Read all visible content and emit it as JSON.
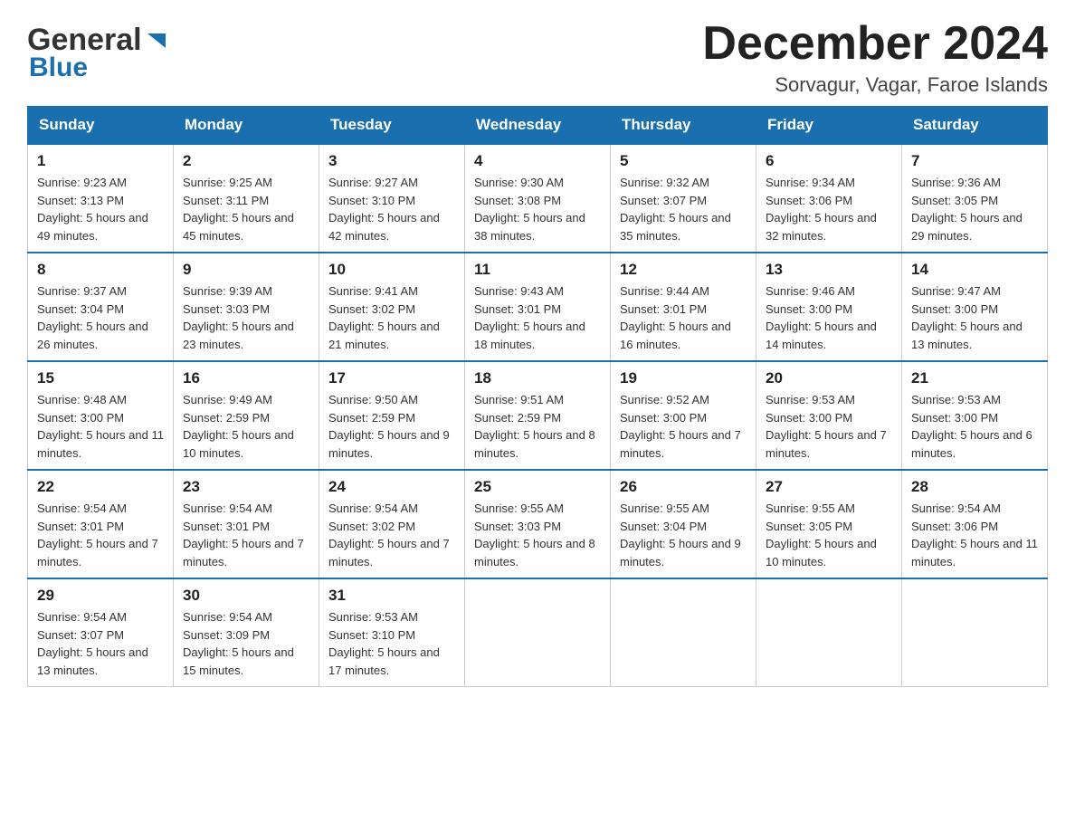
{
  "header": {
    "logo_top": "General",
    "logo_bottom": "Blue",
    "month_title": "December 2024",
    "location": "Sorvagur, Vagar, Faroe Islands"
  },
  "days_of_week": [
    "Sunday",
    "Monday",
    "Tuesday",
    "Wednesday",
    "Thursday",
    "Friday",
    "Saturday"
  ],
  "weeks": [
    [
      {
        "day": "1",
        "sunrise": "Sunrise: 9:23 AM",
        "sunset": "Sunset: 3:13 PM",
        "daylight": "Daylight: 5 hours and 49 minutes."
      },
      {
        "day": "2",
        "sunrise": "Sunrise: 9:25 AM",
        "sunset": "Sunset: 3:11 PM",
        "daylight": "Daylight: 5 hours and 45 minutes."
      },
      {
        "day": "3",
        "sunrise": "Sunrise: 9:27 AM",
        "sunset": "Sunset: 3:10 PM",
        "daylight": "Daylight: 5 hours and 42 minutes."
      },
      {
        "day": "4",
        "sunrise": "Sunrise: 9:30 AM",
        "sunset": "Sunset: 3:08 PM",
        "daylight": "Daylight: 5 hours and 38 minutes."
      },
      {
        "day": "5",
        "sunrise": "Sunrise: 9:32 AM",
        "sunset": "Sunset: 3:07 PM",
        "daylight": "Daylight: 5 hours and 35 minutes."
      },
      {
        "day": "6",
        "sunrise": "Sunrise: 9:34 AM",
        "sunset": "Sunset: 3:06 PM",
        "daylight": "Daylight: 5 hours and 32 minutes."
      },
      {
        "day": "7",
        "sunrise": "Sunrise: 9:36 AM",
        "sunset": "Sunset: 3:05 PM",
        "daylight": "Daylight: 5 hours and 29 minutes."
      }
    ],
    [
      {
        "day": "8",
        "sunrise": "Sunrise: 9:37 AM",
        "sunset": "Sunset: 3:04 PM",
        "daylight": "Daylight: 5 hours and 26 minutes."
      },
      {
        "day": "9",
        "sunrise": "Sunrise: 9:39 AM",
        "sunset": "Sunset: 3:03 PM",
        "daylight": "Daylight: 5 hours and 23 minutes."
      },
      {
        "day": "10",
        "sunrise": "Sunrise: 9:41 AM",
        "sunset": "Sunset: 3:02 PM",
        "daylight": "Daylight: 5 hours and 21 minutes."
      },
      {
        "day": "11",
        "sunrise": "Sunrise: 9:43 AM",
        "sunset": "Sunset: 3:01 PM",
        "daylight": "Daylight: 5 hours and 18 minutes."
      },
      {
        "day": "12",
        "sunrise": "Sunrise: 9:44 AM",
        "sunset": "Sunset: 3:01 PM",
        "daylight": "Daylight: 5 hours and 16 minutes."
      },
      {
        "day": "13",
        "sunrise": "Sunrise: 9:46 AM",
        "sunset": "Sunset: 3:00 PM",
        "daylight": "Daylight: 5 hours and 14 minutes."
      },
      {
        "day": "14",
        "sunrise": "Sunrise: 9:47 AM",
        "sunset": "Sunset: 3:00 PM",
        "daylight": "Daylight: 5 hours and 13 minutes."
      }
    ],
    [
      {
        "day": "15",
        "sunrise": "Sunrise: 9:48 AM",
        "sunset": "Sunset: 3:00 PM",
        "daylight": "Daylight: 5 hours and 11 minutes."
      },
      {
        "day": "16",
        "sunrise": "Sunrise: 9:49 AM",
        "sunset": "Sunset: 2:59 PM",
        "daylight": "Daylight: 5 hours and 10 minutes."
      },
      {
        "day": "17",
        "sunrise": "Sunrise: 9:50 AM",
        "sunset": "Sunset: 2:59 PM",
        "daylight": "Daylight: 5 hours and 9 minutes."
      },
      {
        "day": "18",
        "sunrise": "Sunrise: 9:51 AM",
        "sunset": "Sunset: 2:59 PM",
        "daylight": "Daylight: 5 hours and 8 minutes."
      },
      {
        "day": "19",
        "sunrise": "Sunrise: 9:52 AM",
        "sunset": "Sunset: 3:00 PM",
        "daylight": "Daylight: 5 hours and 7 minutes."
      },
      {
        "day": "20",
        "sunrise": "Sunrise: 9:53 AM",
        "sunset": "Sunset: 3:00 PM",
        "daylight": "Daylight: 5 hours and 7 minutes."
      },
      {
        "day": "21",
        "sunrise": "Sunrise: 9:53 AM",
        "sunset": "Sunset: 3:00 PM",
        "daylight": "Daylight: 5 hours and 6 minutes."
      }
    ],
    [
      {
        "day": "22",
        "sunrise": "Sunrise: 9:54 AM",
        "sunset": "Sunset: 3:01 PM",
        "daylight": "Daylight: 5 hours and 7 minutes."
      },
      {
        "day": "23",
        "sunrise": "Sunrise: 9:54 AM",
        "sunset": "Sunset: 3:01 PM",
        "daylight": "Daylight: 5 hours and 7 minutes."
      },
      {
        "day": "24",
        "sunrise": "Sunrise: 9:54 AM",
        "sunset": "Sunset: 3:02 PM",
        "daylight": "Daylight: 5 hours and 7 minutes."
      },
      {
        "day": "25",
        "sunrise": "Sunrise: 9:55 AM",
        "sunset": "Sunset: 3:03 PM",
        "daylight": "Daylight: 5 hours and 8 minutes."
      },
      {
        "day": "26",
        "sunrise": "Sunrise: 9:55 AM",
        "sunset": "Sunset: 3:04 PM",
        "daylight": "Daylight: 5 hours and 9 minutes."
      },
      {
        "day": "27",
        "sunrise": "Sunrise: 9:55 AM",
        "sunset": "Sunset: 3:05 PM",
        "daylight": "Daylight: 5 hours and 10 minutes."
      },
      {
        "day": "28",
        "sunrise": "Sunrise: 9:54 AM",
        "sunset": "Sunset: 3:06 PM",
        "daylight": "Daylight: 5 hours and 11 minutes."
      }
    ],
    [
      {
        "day": "29",
        "sunrise": "Sunrise: 9:54 AM",
        "sunset": "Sunset: 3:07 PM",
        "daylight": "Daylight: 5 hours and 13 minutes."
      },
      {
        "day": "30",
        "sunrise": "Sunrise: 9:54 AM",
        "sunset": "Sunset: 3:09 PM",
        "daylight": "Daylight: 5 hours and 15 minutes."
      },
      {
        "day": "31",
        "sunrise": "Sunrise: 9:53 AM",
        "sunset": "Sunset: 3:10 PM",
        "daylight": "Daylight: 5 hours and 17 minutes."
      },
      null,
      null,
      null,
      null
    ]
  ]
}
